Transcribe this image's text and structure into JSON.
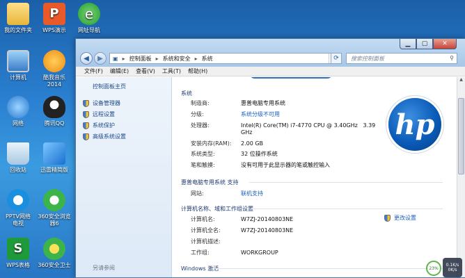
{
  "desktop": {
    "icons": [
      {
        "label": "我的文件夹",
        "icon": "folder-icon",
        "color": "#f2c84b"
      },
      {
        "label": "WPS演示",
        "icon": "wps-presentation-icon",
        "color": "#e85a2a"
      },
      {
        "label": "网址导航",
        "icon": "ie-browser-icon",
        "color": "#1fa02a"
      },
      {
        "label": "计算机",
        "icon": "computer-icon",
        "color": "#5aa0e0"
      },
      {
        "label": "酷我音乐\n2014",
        "icon": "kuwo-music-icon",
        "color": "#f39a1a"
      },
      {
        "label": "网络",
        "icon": "network-icon",
        "color": "#3a8ee0"
      },
      {
        "label": "腾讯QQ",
        "icon": "qq-penguin-icon",
        "color": "#222222"
      },
      {
        "label": "回收站",
        "icon": "recycle-bin-icon",
        "color": "#cfe4f4"
      },
      {
        "label": "迅雷精简版",
        "icon": "xunlei-icon",
        "color": "#2a8ce0"
      },
      {
        "label": "PPTV网络\n电视",
        "icon": "pptv-icon",
        "color": "#1a8fe0"
      },
      {
        "label": "360安全浏览\n器6",
        "icon": "360-browser-icon",
        "color": "#3cb44a"
      },
      {
        "label": "WPS表格",
        "icon": "wps-spreadsheet-icon",
        "color": "#1e9a3a"
      },
      {
        "label": "360安全卫士",
        "icon": "360-safe-icon",
        "color": "#3cb44a"
      }
    ]
  },
  "window": {
    "address": {
      "seg1": "控制面板",
      "seg2": "系统和安全",
      "seg3": "系统",
      "sep": "▸"
    },
    "search_placeholder": "搜索控制面板",
    "menu": [
      "文件(F)",
      "编辑(E)",
      "查看(V)",
      "工具(T)",
      "帮助(H)"
    ],
    "sidebar": {
      "home": "控制面板主页",
      "tasks": [
        "设备管理器",
        "远程设置",
        "系统保护",
        "高级系统设置"
      ],
      "see_also": "另请参阅"
    },
    "system": {
      "section_title": "系统",
      "rows": [
        {
          "k": "制造商:",
          "v": "惠普电脑专用系统"
        },
        {
          "k": "分级:",
          "v": "系统分级不可用"
        },
        {
          "k": "处理器:",
          "v": "Intel(R) Core(TM) i7-4770 CPU @ 3.40GHz   3.39",
          "v2": "GHz"
        },
        {
          "k": "安装内存(RAM):",
          "v": "2.00 GB"
        },
        {
          "k": "系统类型:",
          "v": "32 位操作系统"
        },
        {
          "k": "笔和触摸:",
          "v": "没有可用于此显示器的笔或触控输入"
        }
      ]
    },
    "support": {
      "section_title": "惠普电脑专用系统 支持",
      "rows": [
        {
          "k": "网站:",
          "v": "联机支持"
        }
      ]
    },
    "computer": {
      "section_title": "计算机名称、域和工作组设置",
      "change_label": "更改设置",
      "rows": [
        {
          "k": "计算机名:",
          "v": "W7ZJ-20140803NE"
        },
        {
          "k": "计算机全名:",
          "v": "W7ZJ-20140803NE"
        },
        {
          "k": "计算机描述:",
          "v": ""
        },
        {
          "k": "工作组:",
          "v": "WORKGROUP"
        }
      ]
    },
    "activation": {
      "section_title": "Windows 激活"
    },
    "logo_text": "hp"
  },
  "tray": {
    "percent": "23%",
    "badge_line1": "0.1K/s",
    "badge_line2": "0K/s"
  }
}
